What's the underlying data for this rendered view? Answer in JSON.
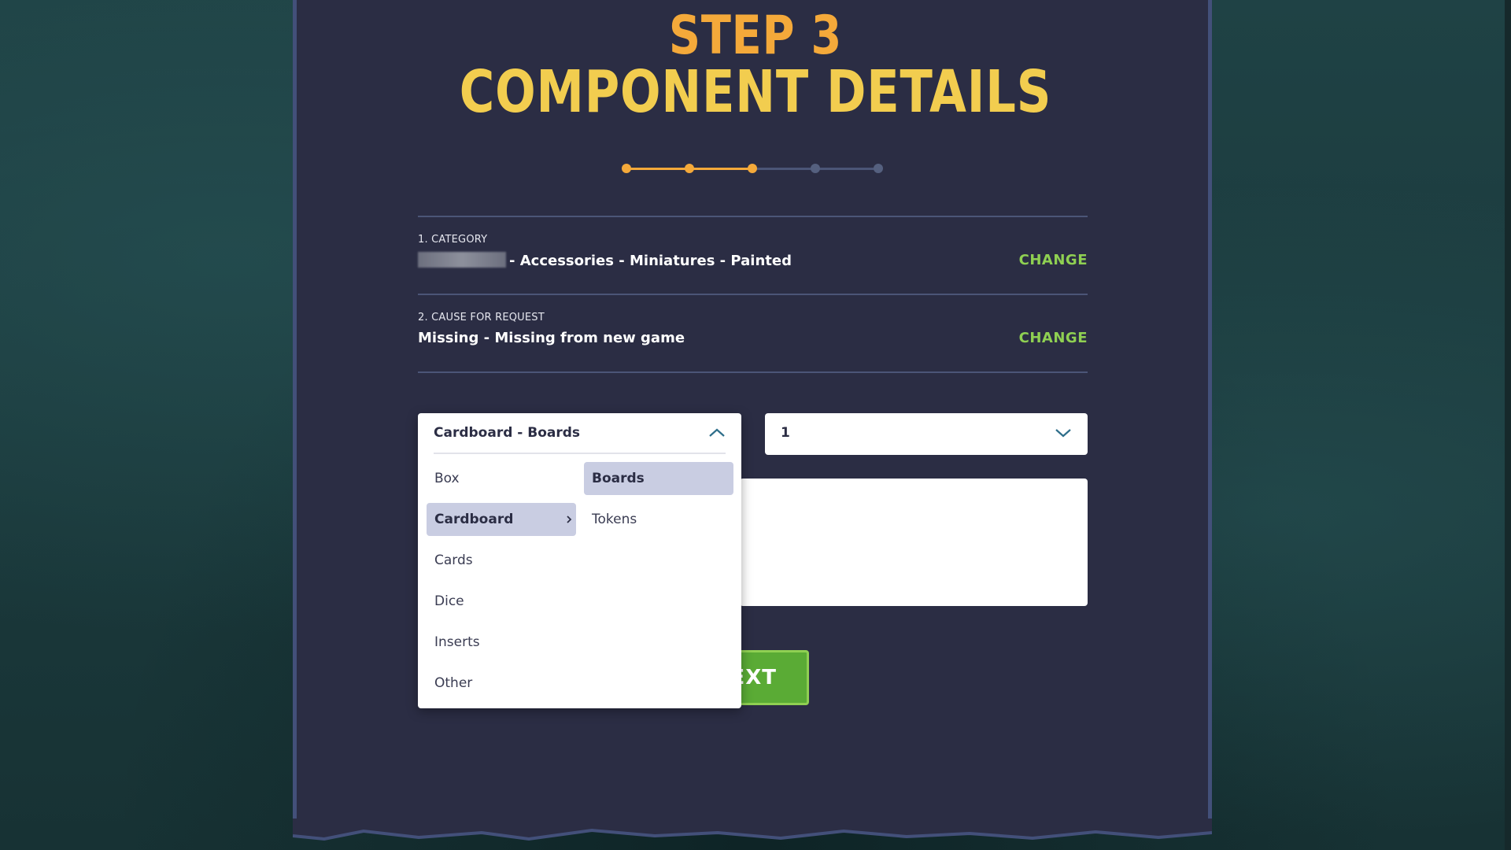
{
  "header": {
    "step": "STEP 3",
    "title": "COMPONENT DETAILS"
  },
  "progress": {
    "total_steps": 5,
    "current_step": 3,
    "active_color": "#f4a93a",
    "inactive_color": "#4b5577"
  },
  "summary": {
    "category": {
      "label": "1. CATEGORY",
      "value": "- Accessories - Miniatures - Painted",
      "change": "CHANGE"
    },
    "cause": {
      "label": "2. CAUSE FOR REQUEST",
      "value": "Missing - Missing from new game",
      "change": "CHANGE"
    }
  },
  "component_select": {
    "selected": "Cardboard - Boards",
    "icon": "chevron-up-icon",
    "primary_options": [
      "Box",
      "Cardboard",
      "Cards",
      "Dice",
      "Inserts",
      "Other"
    ],
    "active_primary": "Cardboard",
    "secondary_options": [
      "Boards",
      "Tokens"
    ],
    "active_secondary": "Boards"
  },
  "quantity_select": {
    "selected": "1",
    "icon": "chevron-down-icon"
  },
  "next_button": {
    "label": "NEXT"
  },
  "colors": {
    "panel": "#2b2d44",
    "accent_green": "#8fd052",
    "title_orange": "#f4a93a",
    "title_yellow": "#f2cd4f"
  }
}
